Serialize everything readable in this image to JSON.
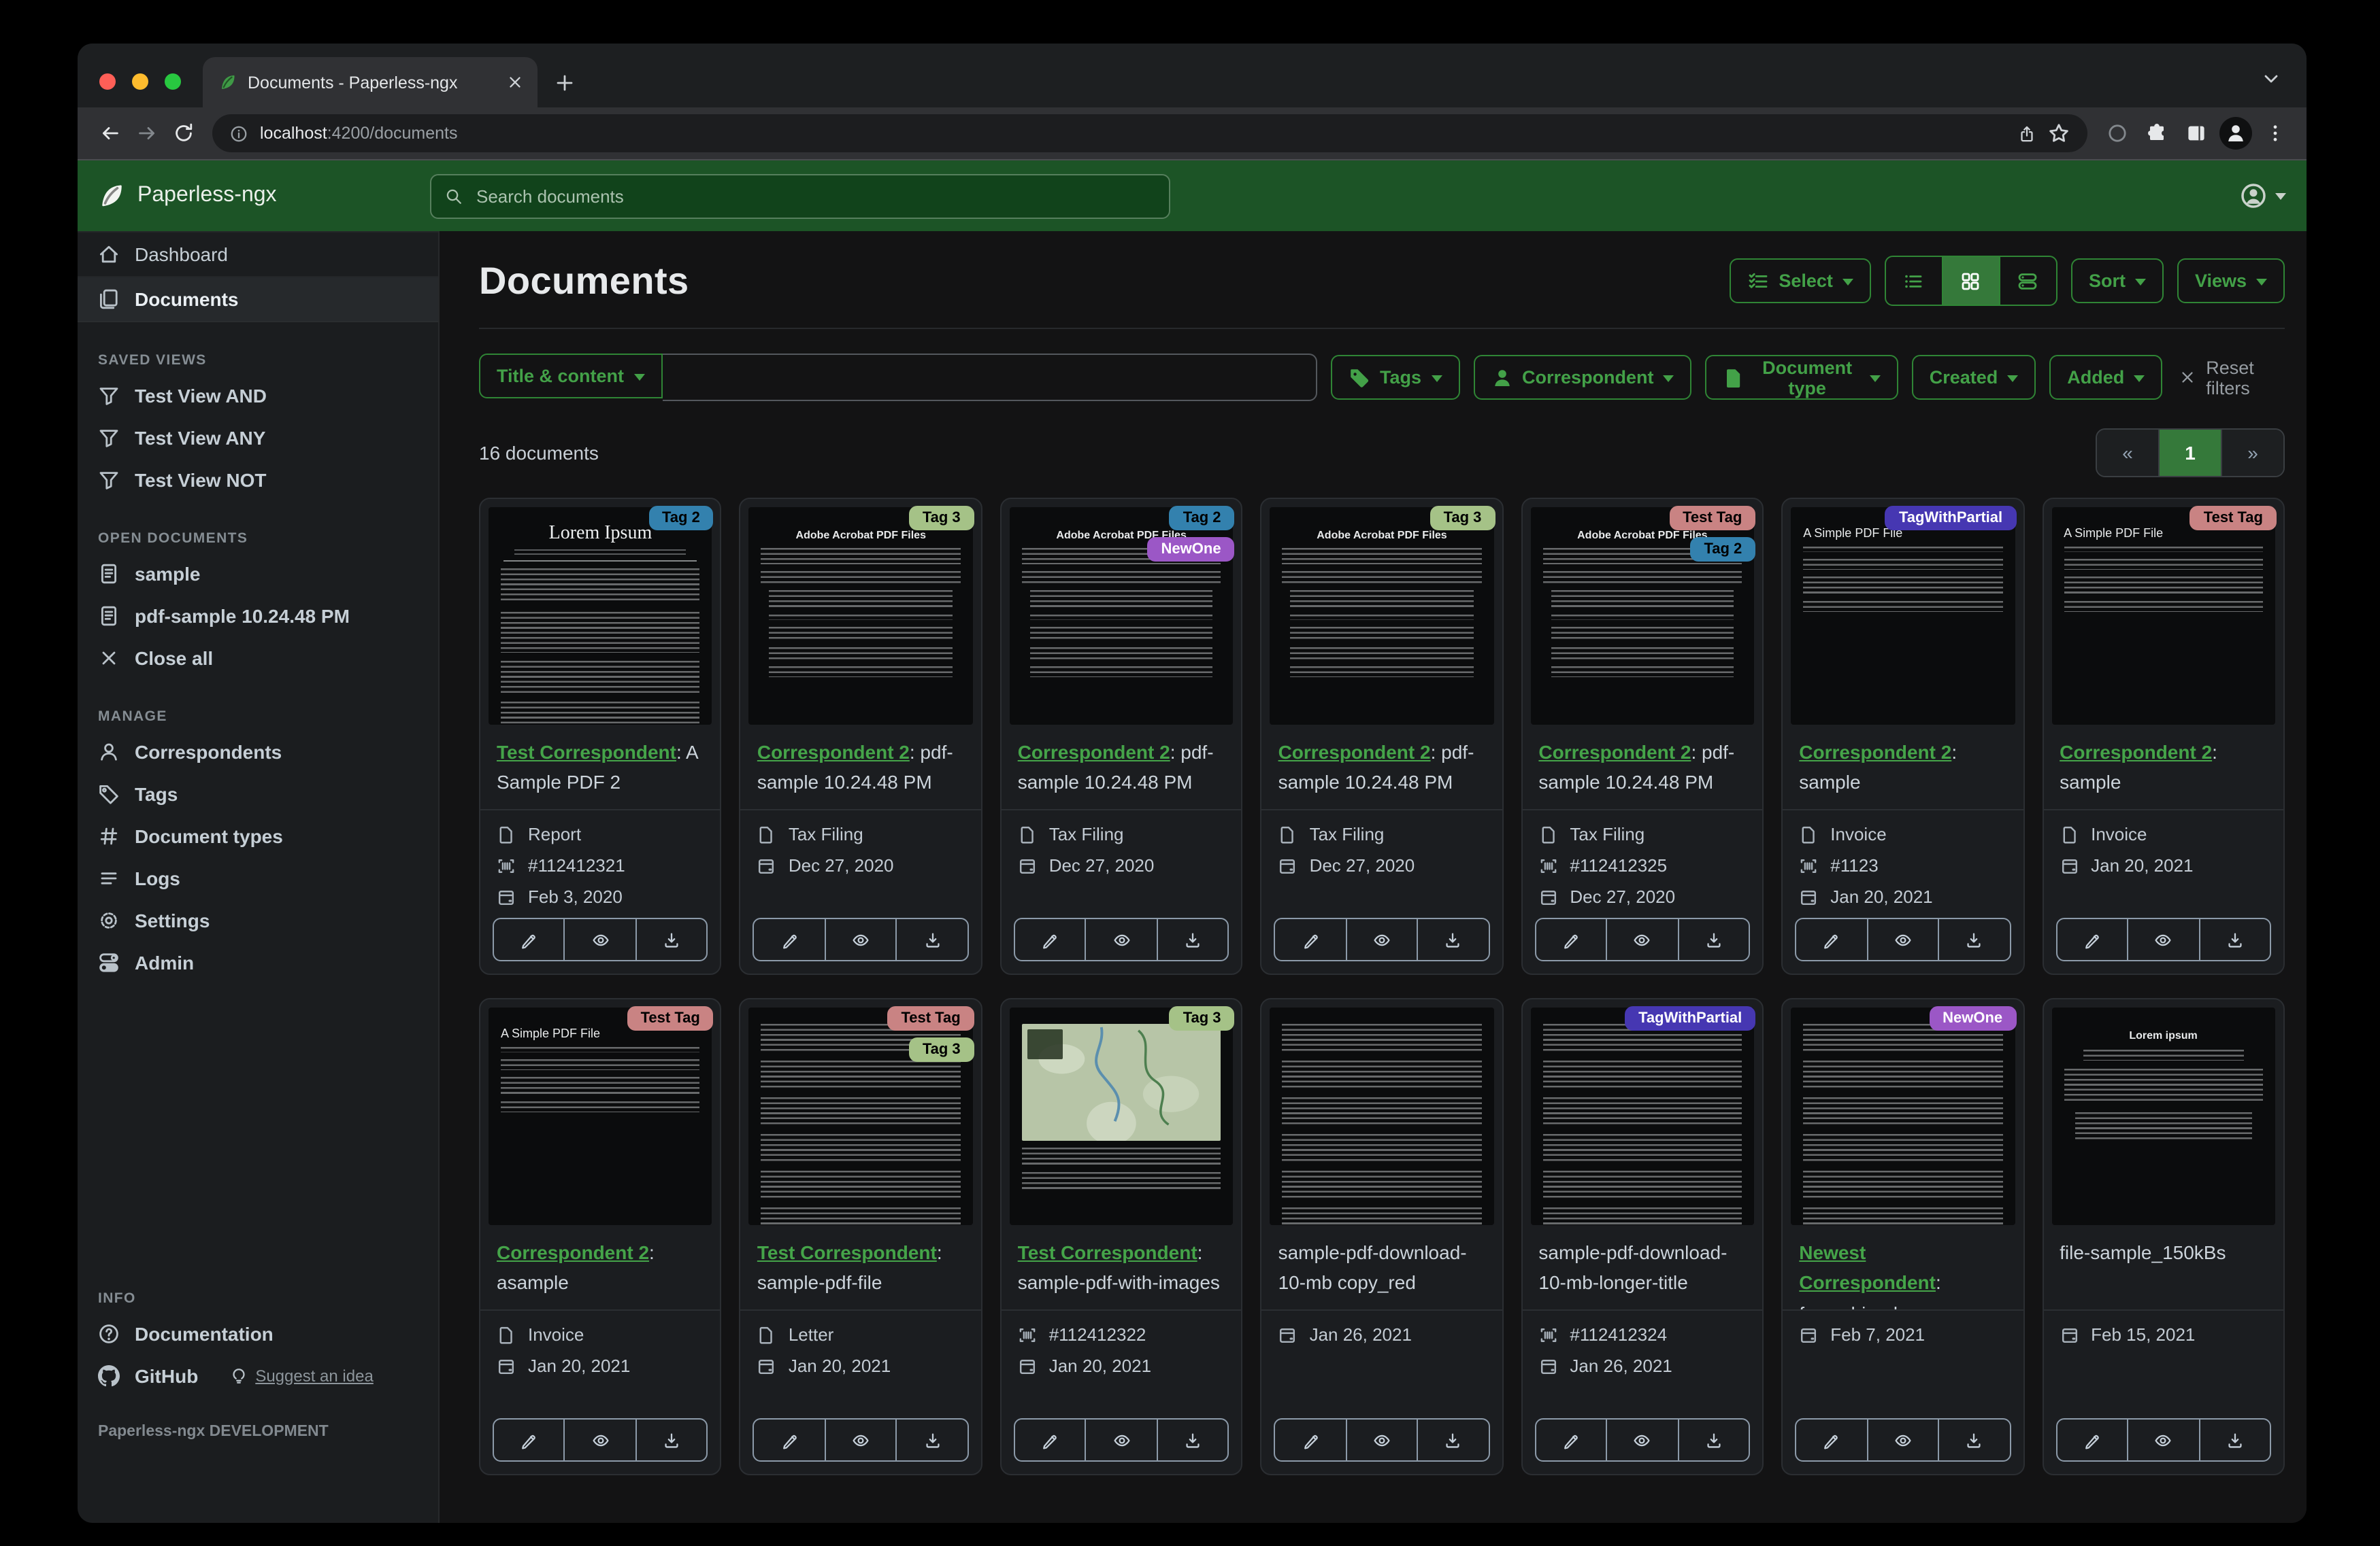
{
  "browser": {
    "tab_title": "Documents - Paperless-ngx",
    "url_host": "localhost",
    "url_rest": ":4200/documents"
  },
  "app": {
    "brand": "Paperless-ngx",
    "search_placeholder": "Search documents",
    "page_title": "Documents",
    "toolbar": {
      "select": "Select",
      "sort": "Sort",
      "views": "Views"
    },
    "filters": {
      "field": "Title & content",
      "tags": "Tags",
      "correspondent": "Correspondent",
      "document_type": "Document type",
      "created": "Created",
      "added": "Added",
      "reset": "Reset filters"
    },
    "count": "16 documents",
    "pagination": {
      "prev": "«",
      "current": "1",
      "next": "»"
    }
  },
  "sidebar": {
    "primary": [
      {
        "icon": "home",
        "label": "Dashboard",
        "active": false
      },
      {
        "icon": "files",
        "label": "Documents",
        "active": true
      }
    ],
    "sections": [
      {
        "heading": "SAVED VIEWS",
        "items": [
          {
            "icon": "funnel",
            "label": "Test View AND"
          },
          {
            "icon": "funnel",
            "label": "Test View ANY"
          },
          {
            "icon": "funnel",
            "label": "Test View NOT"
          }
        ]
      },
      {
        "heading": "OPEN DOCUMENTS",
        "items": [
          {
            "icon": "file-text",
            "label": "sample"
          },
          {
            "icon": "file-text",
            "label": "pdf-sample 10.24.48 PM"
          },
          {
            "icon": "close",
            "label": "Close all"
          }
        ]
      },
      {
        "heading": "MANAGE",
        "items": [
          {
            "icon": "person",
            "label": "Correspondents"
          },
          {
            "icon": "tag",
            "label": "Tags"
          },
          {
            "icon": "hash",
            "label": "Document types"
          },
          {
            "icon": "list",
            "label": "Logs"
          },
          {
            "icon": "gear",
            "label": "Settings"
          },
          {
            "icon": "toggles",
            "label": "Admin"
          }
        ]
      },
      {
        "heading": "INFO",
        "pin_bottom": true,
        "items": [
          {
            "icon": "question",
            "label": "Documentation"
          },
          {
            "icon": "github",
            "label": "GitHub",
            "extra": {
              "icon": "bulb",
              "label": "Suggest an idea"
            }
          }
        ]
      }
    ],
    "footer": "Paperless-ngx DEVELOPMENT"
  },
  "tag_styles": {
    "Tag 2": {
      "bg": "#3381ae",
      "fg": "#000000"
    },
    "Tag 3": {
      "bg": "#a5c287",
      "fg": "#000000"
    },
    "Test Tag": {
      "bg": "#c98383",
      "fg": "#000000"
    },
    "NewOne": {
      "bg": "#9b57c6",
      "fg": "#ffffff"
    },
    "TagWithPartial": {
      "bg": "#4637b2",
      "fg": "#ffffff"
    }
  },
  "cards": [
    {
      "correspondent": "Test Correspondent",
      "title": "A Sample PDF 2",
      "type": "Report",
      "asn": "#112412321",
      "date": "Feb 3, 2020",
      "tags": [
        "Tag 2"
      ],
      "thumb": {
        "variant": "serif",
        "title": "Lorem Ipsum"
      }
    },
    {
      "correspondent": "Correspondent 2",
      "title": "pdf-sample 10.24.48 PM",
      "type": "Tax Filing",
      "date": "Dec 27, 2020",
      "tags": [
        "Tag 3"
      ],
      "thumb": {
        "variant": "adobe",
        "title": "Adobe Acrobat PDF Files"
      }
    },
    {
      "correspondent": "Correspondent 2",
      "title": "pdf-sample 10.24.48 PM",
      "type": "Tax Filing",
      "date": "Dec 27, 2020",
      "tags": [
        "Tag 2",
        "NewOne"
      ],
      "thumb": {
        "variant": "adobe",
        "title": "Adobe Acrobat PDF Files"
      }
    },
    {
      "correspondent": "Correspondent 2",
      "title": "pdf-sample 10.24.48 PM",
      "type": "Tax Filing",
      "date": "Dec 27, 2020",
      "tags": [
        "Tag 3"
      ],
      "thumb": {
        "variant": "adobe",
        "title": "Adobe Acrobat PDF Files"
      }
    },
    {
      "correspondent": "Correspondent 2",
      "title": "pdf-sample 10.24.48 PM",
      "type": "Tax Filing",
      "asn": "#112412325",
      "date": "Dec 27, 2020",
      "tags": [
        "Test Tag",
        "Tag 2"
      ],
      "thumb": {
        "variant": "adobe",
        "title": "Adobe Acrobat PDF Files"
      }
    },
    {
      "correspondent": "Correspondent 2",
      "title": "sample",
      "type": "Invoice",
      "asn": "#1123",
      "date": "Jan 20, 2021",
      "tags": [
        "TagWithPartial"
      ],
      "thumb": {
        "variant": "simple",
        "title": "A Simple PDF File"
      }
    },
    {
      "correspondent": "Correspondent 2",
      "title": "sample",
      "type": "Invoice",
      "date": "Jan 20, 2021",
      "tags": [
        "Test Tag"
      ],
      "thumb": {
        "variant": "simple",
        "title": "A Simple PDF File"
      }
    },
    {
      "correspondent": "Correspondent 2",
      "title": "asample",
      "type": "Invoice",
      "date": "Jan 20, 2021",
      "tags": [
        "Test Tag"
      ],
      "thumb": {
        "variant": "simple",
        "title": "A Simple PDF File"
      }
    },
    {
      "correspondent": "Test Correspondent",
      "title": "sample-pdf-file",
      "type": "Letter",
      "date": "Jan 20, 2021",
      "tags": [
        "Test Tag",
        "Tag 3"
      ],
      "thumb": {
        "variant": "dense",
        "title": ""
      }
    },
    {
      "correspondent": "Test Correspondent",
      "title": "sample-pdf-with-images",
      "asn": "#112412322",
      "date": "Jan 20, 2021",
      "tags": [
        "Tag 3"
      ],
      "thumb": {
        "variant": "map",
        "title": ""
      }
    },
    {
      "title": "sample-pdf-download-10-mb copy_red",
      "date": "Jan 26, 2021",
      "tags": [],
      "thumb": {
        "variant": "dense",
        "title": ""
      }
    },
    {
      "title": "sample-pdf-download-10-mb-longer-title",
      "asn": "#112412324",
      "date": "Jan 26, 2021",
      "tags": [
        "TagWithPartial"
      ],
      "thumb": {
        "variant": "dense",
        "title": ""
      }
    },
    {
      "correspondent": "Newest Correspondent",
      "title": "f_combineds",
      "date": "Feb 7, 2021",
      "tags": [
        "NewOne"
      ],
      "thumb": {
        "variant": "dense",
        "title": ""
      }
    },
    {
      "title": "file-sample_150kBs",
      "date": "Feb 15, 2021",
      "tags": [],
      "thumb": {
        "variant": "center",
        "title": "Lorem ipsum"
      }
    }
  ]
}
